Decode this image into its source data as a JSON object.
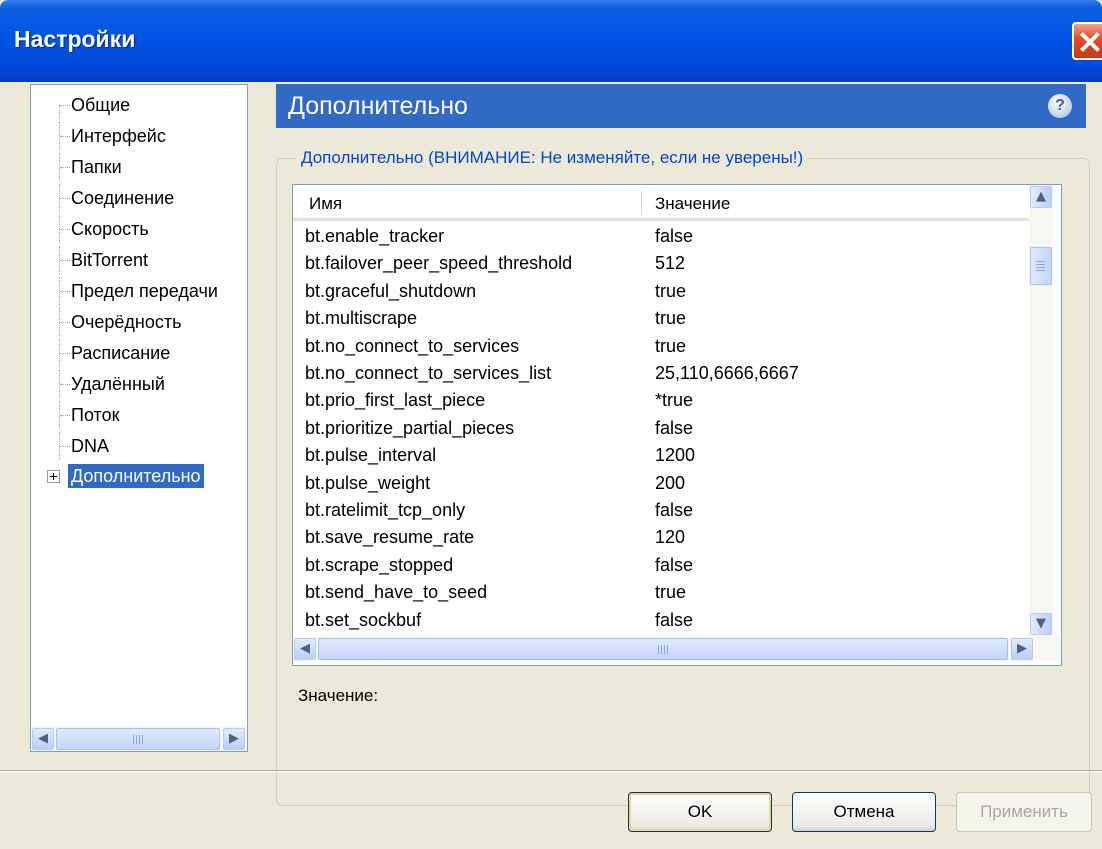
{
  "window": {
    "title": "Настройки"
  },
  "sidebar": {
    "items": [
      {
        "label": "Общие"
      },
      {
        "label": "Интерфейс"
      },
      {
        "label": "Папки"
      },
      {
        "label": "Соединение"
      },
      {
        "label": "Скорость"
      },
      {
        "label": "BitTorrent"
      },
      {
        "label": "Предел передачи"
      },
      {
        "label": "Очерёдность"
      },
      {
        "label": "Расписание"
      },
      {
        "label": "Удалённый"
      },
      {
        "label": "Поток"
      },
      {
        "label": "DNA"
      },
      {
        "label": "Дополнительно",
        "selected": true,
        "expandable": true
      }
    ]
  },
  "panel": {
    "title": "Дополнительно",
    "group_title": "Дополнительно (ВНИМАНИЕ: Не изменяйте, если не уверены!)",
    "columns": {
      "name": "Имя",
      "value": "Значение"
    },
    "rows": [
      {
        "name": "bt.enable_tracker",
        "value": "false"
      },
      {
        "name": "bt.failover_peer_speed_threshold",
        "value": "512"
      },
      {
        "name": "bt.graceful_shutdown",
        "value": "true"
      },
      {
        "name": "bt.multiscrape",
        "value": "true"
      },
      {
        "name": "bt.no_connect_to_services",
        "value": "true"
      },
      {
        "name": "bt.no_connect_to_services_list",
        "value": "25,110,6666,6667"
      },
      {
        "name": "bt.prio_first_last_piece",
        "value": "*true"
      },
      {
        "name": "bt.prioritize_partial_pieces",
        "value": "false"
      },
      {
        "name": "bt.pulse_interval",
        "value": "1200"
      },
      {
        "name": "bt.pulse_weight",
        "value": "200"
      },
      {
        "name": "bt.ratelimit_tcp_only",
        "value": "false"
      },
      {
        "name": "bt.save_resume_rate",
        "value": "120"
      },
      {
        "name": "bt.scrape_stopped",
        "value": "false"
      },
      {
        "name": "bt.send_have_to_seed",
        "value": "true"
      },
      {
        "name": "bt.set_sockbuf",
        "value": "false"
      }
    ],
    "value_label": "Значение:"
  },
  "buttons": {
    "ok": "OK",
    "cancel": "Отмена",
    "apply": "Применить"
  },
  "icons": {
    "help": "?",
    "close": "close-icon"
  },
  "colors": {
    "titlebar": "#0055e5",
    "selection": "#316ac5",
    "group_title": "#0046d5"
  }
}
